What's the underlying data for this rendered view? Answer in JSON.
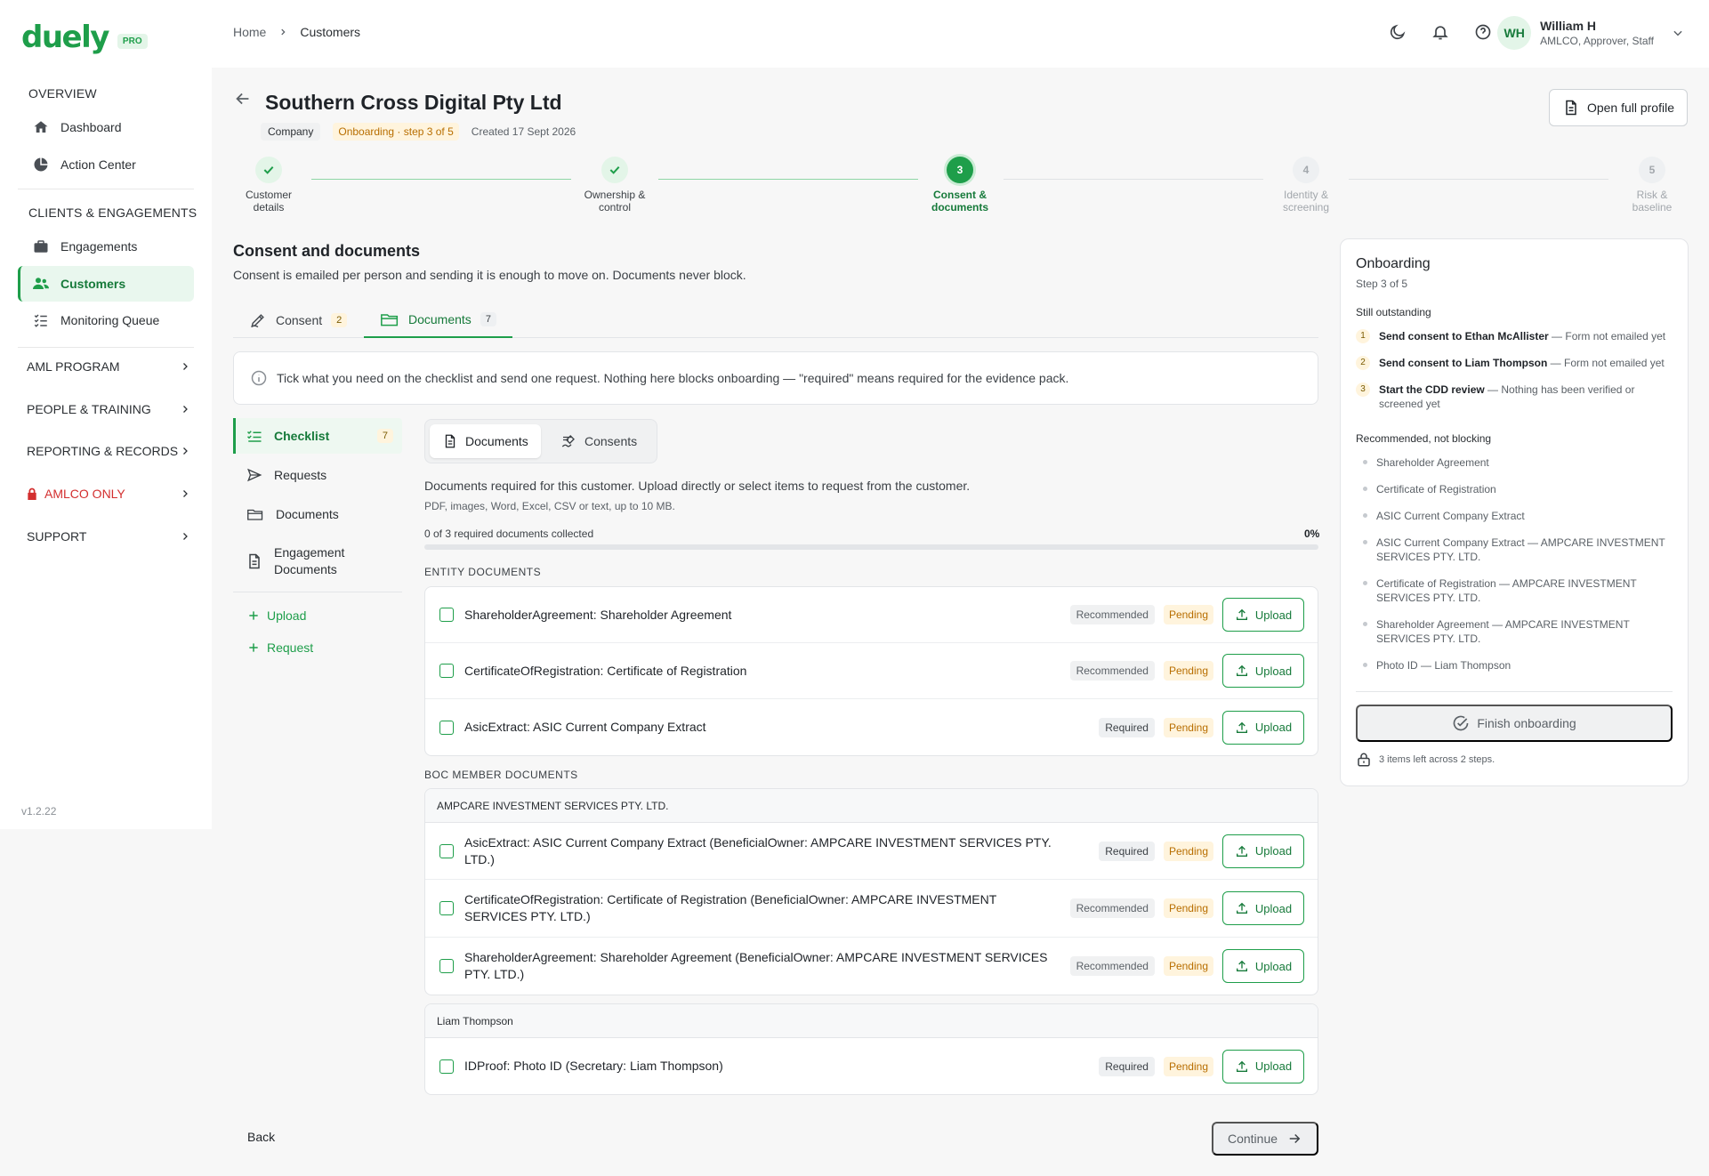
{
  "brand": {
    "logo": "duely",
    "badge": "PRO",
    "version": "v1.2.22"
  },
  "sidebar": {
    "overview_label": "OVERVIEW",
    "overview_items": [
      {
        "label": "Dashboard",
        "icon": "home-icon"
      },
      {
        "label": "Action Center",
        "icon": "pie-icon"
      }
    ],
    "clients_label": "CLIENTS & ENGAGEMENTS",
    "clients_items": [
      {
        "label": "Engagements",
        "icon": "briefcase-icon"
      },
      {
        "label": "Customers",
        "icon": "users-icon",
        "active": true
      },
      {
        "label": "Monitoring Queue",
        "icon": "list-check-icon"
      }
    ],
    "groups": [
      {
        "label": "AML PROGRAM"
      },
      {
        "label": "PEOPLE & TRAINING"
      },
      {
        "label": "REPORTING & RECORDS"
      },
      {
        "label": "AMLCO ONLY",
        "color": "#d32f2f"
      },
      {
        "label": "SUPPORT"
      }
    ]
  },
  "topbar": {
    "breadcrumbs": [
      "Home",
      "Customers"
    ],
    "icons": [
      "moon-icon",
      "bell-icon",
      "help-icon"
    ],
    "user": {
      "initials": "WH",
      "name": "William H",
      "role": "AMLCO, Approver, Staff"
    }
  },
  "header": {
    "title": "Southern Cross Digital Pty Ltd",
    "type_badge": "Company",
    "onboarding_badge": "Onboarding · step 3 of 5",
    "created": "Created 17 Sept 2026",
    "open_profile_label": "Open full profile"
  },
  "stepper": {
    "steps": [
      {
        "number": "1",
        "label_1": "Customer",
        "label_2": "details",
        "state": "done"
      },
      {
        "number": "2",
        "label_1": "Ownership &",
        "label_2": "control",
        "state": "done"
      },
      {
        "number": "3",
        "label_1": "Consent &",
        "label_2": "documents",
        "state": "current"
      },
      {
        "number": "4",
        "label_1": "Identity &",
        "label_2": "screening",
        "state": "todo"
      },
      {
        "number": "5",
        "label_1": "Risk &",
        "label_2": "baseline",
        "state": "todo"
      }
    ]
  },
  "section": {
    "title": "Consent and documents",
    "subtitle": "Consent is emailed per person and sending it is enough to move on. Documents never block."
  },
  "tabs": [
    {
      "label": "Consent",
      "count": "2"
    },
    {
      "label": "Documents",
      "count": "7",
      "active": true
    }
  ],
  "info_text": "Tick what you need on the checklist and send one request. Nothing here blocks onboarding — \"required\" means required for the evidence pack.",
  "subnav": {
    "items": [
      {
        "label": "Checklist",
        "count": "7",
        "active": true
      },
      {
        "label": "Requests"
      },
      {
        "label": "Documents"
      },
      {
        "label_1": "Engagement",
        "label_2": "Documents"
      }
    ],
    "actions": [
      "Upload",
      "Request"
    ]
  },
  "segmented": [
    "Documents",
    "Consents"
  ],
  "docs": {
    "description": "Documents required for this customer. Upload directly or select items to request from the customer.",
    "hint": "PDF, images, Word, Excel, CSV or text, up to 10 MB.",
    "progress_label": "0 of 3 required documents collected",
    "progress_pct": "0%",
    "progress_value": 0,
    "upload_label": "Upload",
    "entity_label": "ENTITY DOCUMENTS",
    "entity_rows": [
      {
        "text": "ShareholderAgreement: Shareholder Agreement",
        "level": "Recommended",
        "status": "Pending"
      },
      {
        "text": "CertificateOfRegistration: Certificate of Registration",
        "level": "Recommended",
        "status": "Pending"
      },
      {
        "text": "AsicExtract: ASIC Current Company Extract",
        "level": "Required",
        "status": "Pending"
      }
    ],
    "boc_label": "BOC MEMBER DOCUMENTS",
    "boc_groups": [
      {
        "name": "AMPCARE INVESTMENT SERVICES PTY. LTD.",
        "rows": [
          {
            "text": "AsicExtract: ASIC Current Company Extract (BeneficialOwner: AMPCARE INVESTMENT SERVICES PTY. LTD.)",
            "level": "Required",
            "status": "Pending"
          },
          {
            "text": "CertificateOfRegistration: Certificate of Registration (BeneficialOwner: AMPCARE INVESTMENT SERVICES PTY. LTD.)",
            "level": "Recommended",
            "status": "Pending"
          },
          {
            "text": "ShareholderAgreement: Shareholder Agreement (BeneficialOwner: AMPCARE INVESTMENT SERVICES PTY. LTD.)",
            "level": "Recommended",
            "status": "Pending"
          }
        ]
      },
      {
        "name": "Liam Thompson",
        "rows": [
          {
            "text": "IDProof: Photo ID (Secretary: Liam Thompson)",
            "level": "Required",
            "status": "Pending"
          }
        ]
      }
    ]
  },
  "footer": {
    "back_label": "Back",
    "continue_label": "Continue"
  },
  "panel": {
    "title": "Onboarding",
    "step": "Step 3 of 5",
    "outstanding_label": "Still outstanding",
    "outstanding": [
      {
        "num": "1",
        "action": "Send consent to Ethan McAllister",
        "note": " — Form not emailed yet"
      },
      {
        "num": "2",
        "action": "Send consent to Liam Thompson",
        "note": " — Form not emailed yet"
      },
      {
        "num": "3",
        "action": "Start the CDD review",
        "note": " — Nothing has been verified or screened yet"
      }
    ],
    "recommended_label": "Recommended, not blocking",
    "recommended": [
      "Shareholder Agreement",
      "Certificate of Registration",
      "ASIC Current Company Extract",
      "ASIC Current Company Extract — AMPCARE INVESTMENT SERVICES PTY. LTD.",
      "Certificate of Registration — AMPCARE INVESTMENT SERVICES PTY. LTD.",
      "Shareholder Agreement — AMPCARE INVESTMENT SERVICES PTY. LTD.",
      "Photo ID — Liam Thompson"
    ],
    "finish_label": "Finish onboarding",
    "footnote": "3 items left across 2 steps."
  },
  "colors": {
    "brand": "#1e9e4a",
    "pending": "#b86e00",
    "danger": "#d32f2f"
  }
}
